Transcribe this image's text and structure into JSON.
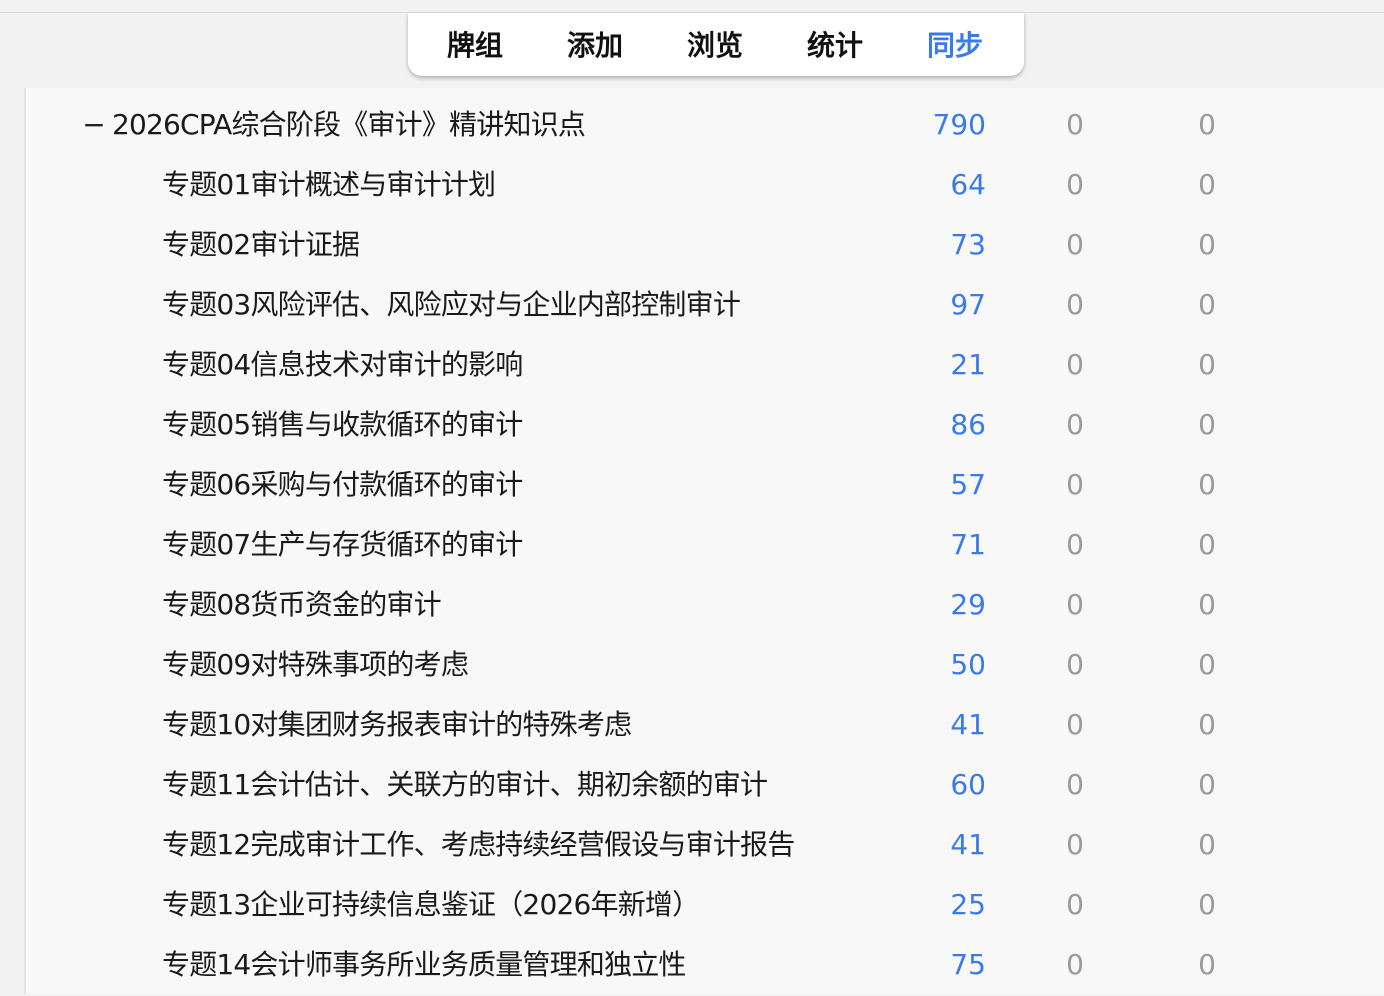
{
  "toolbar": {
    "tabs": [
      {
        "label": "牌组",
        "active": false
      },
      {
        "label": "添加",
        "active": false
      },
      {
        "label": "浏览",
        "active": false
      },
      {
        "label": "统计",
        "active": false
      },
      {
        "label": "同步",
        "active": true
      }
    ]
  },
  "colors": {
    "accent": "#3a7be8",
    "muted": "#9a9a9a",
    "text": "#1a1a1a"
  },
  "deck": {
    "collapse_symbol": "−",
    "name": "2026CPA综合阶段《审计》精讲知识点",
    "new": "790",
    "learn": "0",
    "due": "0",
    "subdecks": [
      {
        "name": "专题01审计概述与审计计划",
        "new": "64",
        "learn": "0",
        "due": "0"
      },
      {
        "name": "专题02审计证据",
        "new": "73",
        "learn": "0",
        "due": "0"
      },
      {
        "name": "专题03风险评估、风险应对与企业内部控制审计",
        "new": "97",
        "learn": "0",
        "due": "0"
      },
      {
        "name": "专题04信息技术对审计的影响",
        "new": "21",
        "learn": "0",
        "due": "0"
      },
      {
        "name": "专题05销售与收款循环的审计",
        "new": "86",
        "learn": "0",
        "due": "0"
      },
      {
        "name": "专题06采购与付款循环的审计",
        "new": "57",
        "learn": "0",
        "due": "0"
      },
      {
        "name": "专题07生产与存货循环的审计",
        "new": "71",
        "learn": "0",
        "due": "0"
      },
      {
        "name": "专题08货币资金的审计",
        "new": "29",
        "learn": "0",
        "due": "0"
      },
      {
        "name": "专题09对特殊事项的考虑",
        "new": "50",
        "learn": "0",
        "due": "0"
      },
      {
        "name": "专题10对集团财务报表审计的特殊考虑",
        "new": "41",
        "learn": "0",
        "due": "0"
      },
      {
        "name": "专题11会计估计、关联方的审计、期初余额的审计",
        "new": "60",
        "learn": "0",
        "due": "0"
      },
      {
        "name": "专题12完成审计工作、考虑持续经营假设与审计报告",
        "new": "41",
        "learn": "0",
        "due": "0"
      },
      {
        "name": "专题13企业可持续信息鉴证（2026年新增）",
        "new": "25",
        "learn": "0",
        "due": "0"
      },
      {
        "name": "专题14会计师事务所业务质量管理和独立性",
        "new": "75",
        "learn": "0",
        "due": "0"
      }
    ]
  }
}
